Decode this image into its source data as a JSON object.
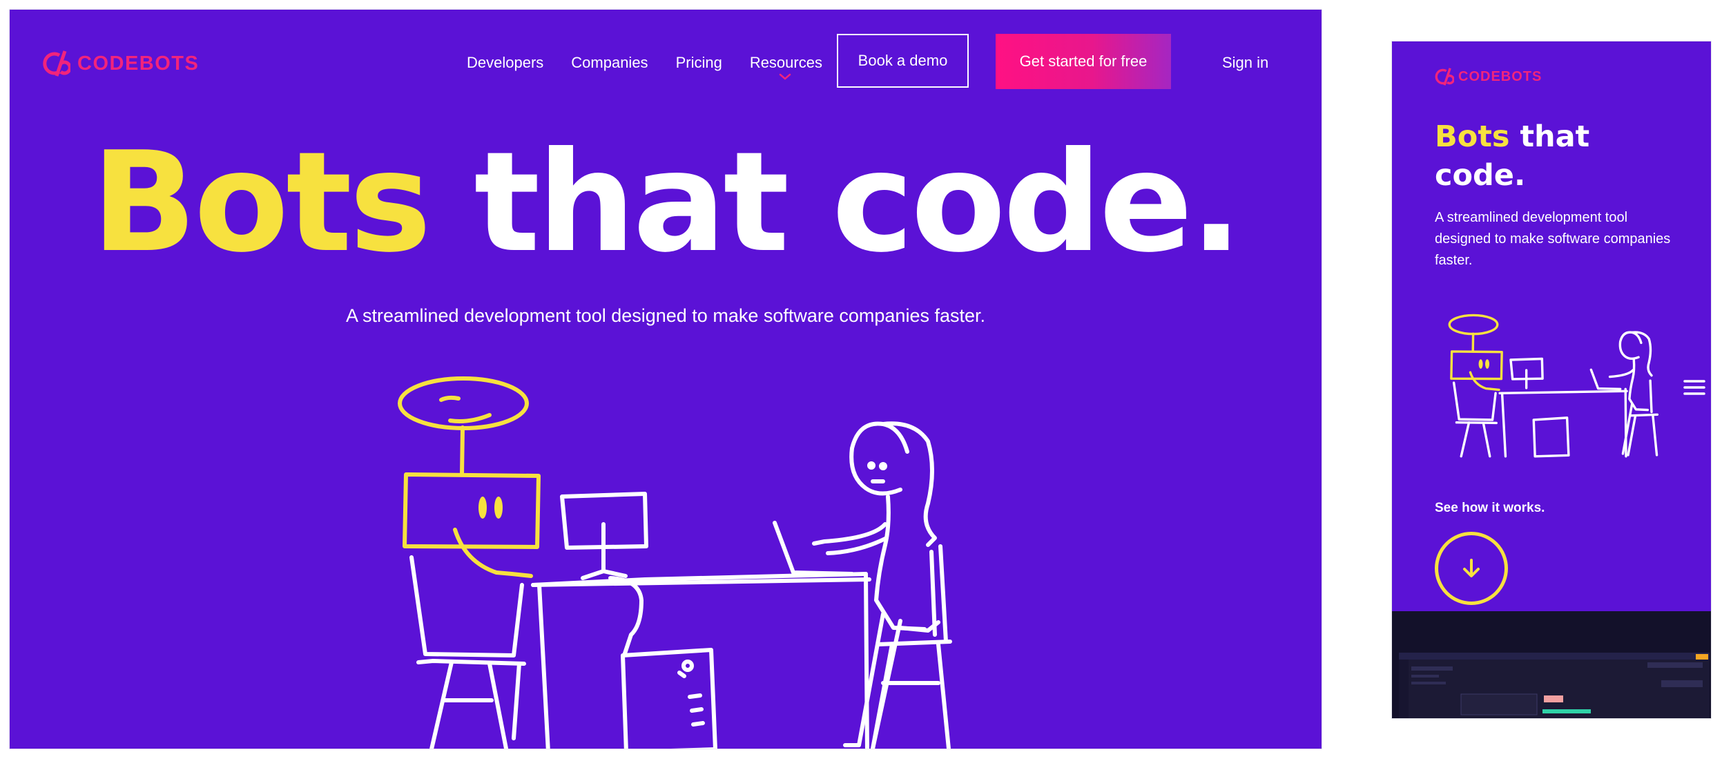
{
  "brand": {
    "name": "CODEBOTS",
    "color": "#f2247b"
  },
  "nav": {
    "items": [
      "Developers",
      "Companies",
      "Pricing",
      "Resources"
    ],
    "book_demo": "Book a demo",
    "get_started": "Get started for free",
    "sign_in": "Sign in"
  },
  "hero": {
    "title_highlight": "Bots",
    "title_rest": " that code.",
    "subtitle": "A streamlined development tool designed to make software companies faster."
  },
  "mobile": {
    "title_highlight": "Bots",
    "title_rest": " that code.",
    "subtitle": "A streamlined development tool designed to make software companies faster.",
    "see_how": "See how it works."
  },
  "colors": {
    "background": "#5b12d6",
    "accent_yellow": "#f7e13f",
    "accent_pink": "#ff1183",
    "dark_section": "#13112a"
  },
  "icons": [
    "codebots-logo-icon",
    "chevron-down-icon",
    "hamburger-menu-icon",
    "arrow-down-icon"
  ]
}
